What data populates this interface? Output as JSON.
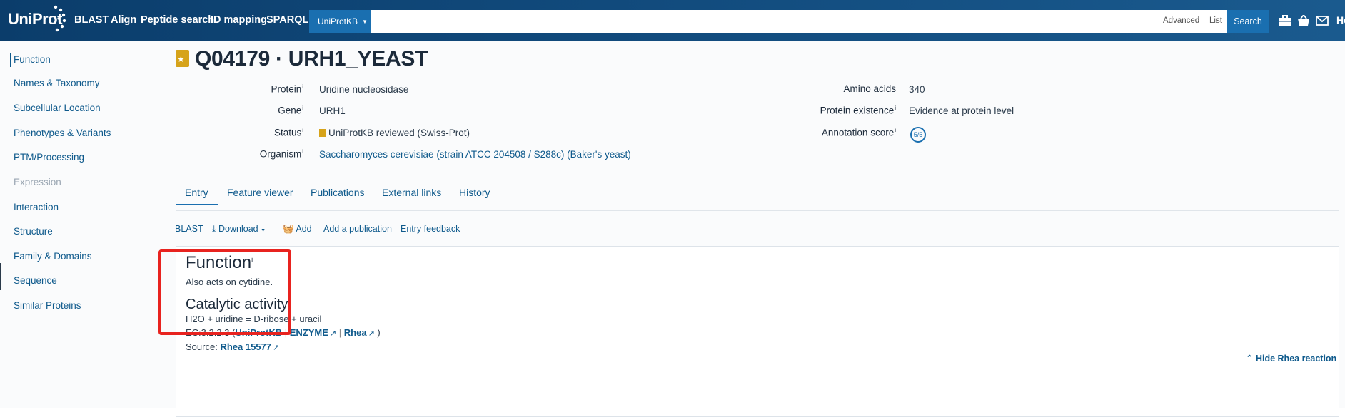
{
  "header": {
    "logo": "UniProt",
    "nav": [
      "BLAST",
      "Align",
      "Peptide search",
      "ID mapping",
      "SPARQL"
    ],
    "db_select": "UniProtKB",
    "search_placeholder": "",
    "advanced": "Advanced",
    "list": "List",
    "search_button": "Search",
    "help": "He"
  },
  "sidebar": {
    "items": [
      {
        "label": "Function"
      },
      {
        "label": "Names & Taxonomy"
      },
      {
        "label": "Subcellular Location"
      },
      {
        "label": "Phenotypes & Variants"
      },
      {
        "label": "PTM/Processing"
      },
      {
        "label": "Expression"
      },
      {
        "label": "Interaction"
      },
      {
        "label": "Structure"
      },
      {
        "label": "Family & Domains"
      },
      {
        "label": "Sequence"
      },
      {
        "label": "Similar Proteins"
      }
    ]
  },
  "entry": {
    "title": "Q04179 · URH1_YEAST",
    "protein_label": "Protein",
    "protein": "Uridine nucleosidase",
    "gene_label": "Gene",
    "gene": "URH1",
    "status_label": "Status",
    "status": "UniProtKB reviewed (Swiss-Prot)",
    "organism_label": "Organism",
    "organism": "Saccharomyces cerevisiae (strain ATCC 204508 / S288c) (Baker's yeast)",
    "amino_acids_label": "Amino acids",
    "amino_acids": "340",
    "existence_label": "Protein existence",
    "existence": "Evidence at protein level",
    "score_label": "Annotation score",
    "score": "5/5",
    "info_mark": "i"
  },
  "tabs": [
    "Entry",
    "Feature viewer",
    "Publications",
    "External links",
    "History"
  ],
  "actions": {
    "blast": "BLAST",
    "download": "Download",
    "add": "Add",
    "add_publication": "Add a publication",
    "feedback": "Entry feedback"
  },
  "function_section": {
    "title": "Function",
    "description": "Also acts on cytidine.",
    "catalytic_title": "Catalytic activity",
    "reaction": "H2O + uridine = D-ribose + uracil",
    "ec_prefix": "EC:3.2.2.3 (",
    "ec_uniprotkb": "UniProtKB",
    "ec_enzyme": "ENZYME",
    "ec_rhea": "Rhea",
    "ec_close": ")",
    "source_label": "Source:",
    "source_link": "Rhea 15577",
    "hide_rhea": "Hide Rhea reaction"
  },
  "colors": {
    "header": "#0b3d6b",
    "accent": "#1a6fb0",
    "link": "#0f5a8c",
    "highlight": "#e8231f"
  }
}
